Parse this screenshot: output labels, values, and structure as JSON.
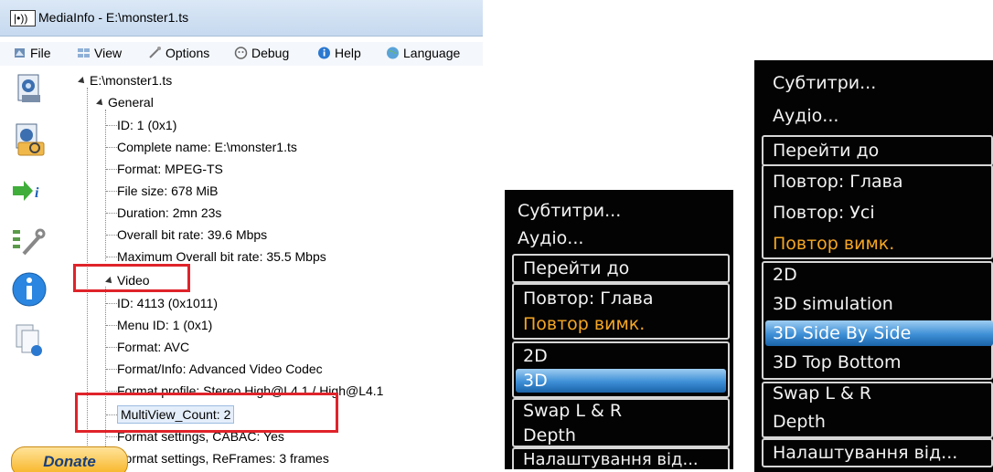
{
  "mediainfo": {
    "window_title": "MediaInfo - E:\\monster1.ts",
    "logo_text": "|•))",
    "menu": [
      {
        "label": "File",
        "icon": "file-icon"
      },
      {
        "label": "View",
        "icon": "view-icon"
      },
      {
        "label": "Options",
        "icon": "options-icon"
      },
      {
        "label": "Debug",
        "icon": "debug-icon"
      },
      {
        "label": "Help",
        "icon": "help-icon"
      },
      {
        "label": "Language",
        "icon": "globe-icon"
      }
    ],
    "toolbar_icons": [
      "open-file-icon",
      "open-folder-icon",
      "export-icon",
      "preferences-icon",
      "about-icon",
      "knowledge-base-icon"
    ],
    "tree": {
      "root": "E:\\monster1.ts",
      "general_label": "General",
      "general": [
        "ID: 1 (0x1)",
        "Complete name: E:\\monster1.ts",
        "Format: MPEG-TS",
        "File size: 678 MiB",
        "Duration: 2mn 23s",
        "Overall bit rate: 39.6 Mbps",
        "Maximum Overall bit rate: 35.5 Mbps"
      ],
      "video_label": "Video",
      "video": [
        "ID: 4113 (0x1011)",
        "Menu ID: 1 (0x1)",
        "Format: AVC",
        "Format/Info: Advanced Video Codec",
        "Format profile: Stereo High@L4.1 / High@L4.1",
        "MultiView_Count: 2",
        "Format settings, CABAC: Yes",
        "Format settings, ReFrames: 3 frames"
      ]
    },
    "donate_label": "Donate"
  },
  "tv_menu_small": {
    "items": [
      "Субтитри...",
      "Аудіо...",
      "Перейти до",
      "Повтор: Глава",
      "Повтор вимк.",
      "2D",
      "3D",
      "Swap L & R",
      "Depth",
      "Налаштування від..."
    ],
    "highlighted": "3D",
    "active_orange": "Повтор вимк."
  },
  "tv_menu_large": {
    "items": [
      "Субтитри...",
      "Аудіо...",
      "Перейти до",
      "Повтор: Глава",
      "Повтор: Усі",
      "Повтор вимк.",
      "2D",
      "3D simulation",
      "3D Side By Side",
      "3D Top Bottom",
      "Swap L & R",
      "Depth",
      "Налаштування від..."
    ],
    "highlighted": "3D Side By Side",
    "active_orange": "Повтор вимк."
  },
  "colors": {
    "annotation_red": "#e0232a",
    "tv_orange": "#f5a623",
    "tv_highlight": "#3d8fd6"
  }
}
